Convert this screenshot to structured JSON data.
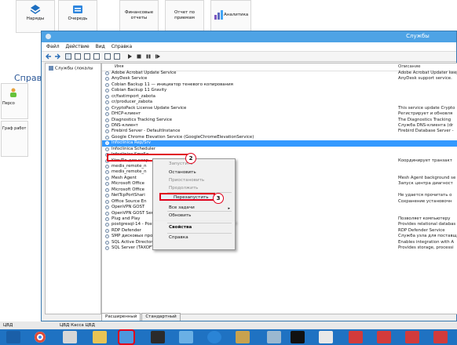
{
  "background_app": {
    "ribbon": [
      "Наряды",
      "Очередь",
      "Финансовые отчеты",
      "Отчет по приемам",
      "Аналитика"
    ],
    "section_title": "Справ",
    "side_tiles": [
      "Персо",
      "Граф работ"
    ]
  },
  "window": {
    "title": "Службы",
    "menu": [
      "Файл",
      "Действие",
      "Вид",
      "Справка"
    ],
    "tree_root": "Службы (локалы",
    "columns": {
      "name": "Имя",
      "description": "Описание"
    },
    "rows": [
      {
        "name": "Adobe Acrobat Update Service",
        "desc": "Adobe Acrobat Updater keeps"
      },
      {
        "name": "AnyDesk Service",
        "desc": "AnyDesk support service."
      },
      {
        "name": "Cobian Backup 11 — инициатор теневого копирования",
        "desc": ""
      },
      {
        "name": "Cobian Backup 11 Gravity",
        "desc": ""
      },
      {
        "name": "cr/fastimport_zabota",
        "desc": ""
      },
      {
        "name": "cr/producer_zabota",
        "desc": ""
      },
      {
        "name": "CryptoPack License Update Service",
        "desc": "This service update Crypto"
      },
      {
        "name": "DHCP-клиент",
        "desc": "Регистрирует и обновля"
      },
      {
        "name": "Diagnostics Tracking Service",
        "desc": "The Diagnostics Tracking"
      },
      {
        "name": "DNS-клиент",
        "desc": "Служба DNS-клиента (dr"
      },
      {
        "name": "Firebird Server - DefaultInstance",
        "desc": "Firebird Database Server -"
      },
      {
        "name": "Google Chrome Elevation Service (GoogleChromeElevationService)",
        "desc": ""
      },
      {
        "name": "Infoclinica Rep/Srv",
        "desc": ""
      },
      {
        "name": "Infoclinica Scheduler",
        "desc": ""
      },
      {
        "name": "Infoclinica SmsSe",
        "desc": ""
      },
      {
        "name": "Ktm/Rn для коор",
        "desc": "Координирует транзакт"
      },
      {
        "name": "medis_remote_n",
        "desc": ""
      },
      {
        "name": "medis_remote_n",
        "desc": ""
      },
      {
        "name": "Mesh Agent",
        "desc": "Mesh Agent background se"
      },
      {
        "name": "Microsoft Office",
        "desc": "Запуск центра диагност"
      },
      {
        "name": "Microsoft Office",
        "desc": ""
      },
      {
        "name": "NetTcpPortShari",
        "desc": "Не удается прочитать о"
      },
      {
        "name": "Office Source En",
        "desc": "Сохранение установочн"
      },
      {
        "name": "OpenVPN GOST",
        "desc": ""
      },
      {
        "name": "OpenVPN GOST Service",
        "desc": ""
      },
      {
        "name": "Plug and Play",
        "desc": "Позволяет компьютеру"
      },
      {
        "name": "postgresql-14 - PostgreSQL Server 14",
        "desc": "Provides relational databas"
      },
      {
        "name": "RDP Defender",
        "desc": "RDP Defender Service"
      },
      {
        "name": "SMP дисковых пространств (Майкрософт)",
        "desc": "Служба узла для поставщ"
      },
      {
        "name": "SQL Active Directory Helper Service",
        "desc": "Enables integration with A"
      },
      {
        "name": "SQL Server (TAXOFTNET)",
        "desc": "Provides storage, processi"
      }
    ],
    "selected_index": 12,
    "tabs": [
      "Расширенный",
      "Стандартный"
    ]
  },
  "context_menu": {
    "items": [
      {
        "label": "Запустить",
        "disabled": true
      },
      {
        "label": "Остановить",
        "disabled": false
      },
      {
        "label": "Приостановить",
        "disabled": true
      },
      {
        "label": "Продолжить",
        "disabled": true
      },
      {
        "label": "Перезапустить",
        "disabled": false
      },
      {
        "label": "Все задачи",
        "disabled": false
      },
      {
        "label": "Обновить",
        "disabled": false
      },
      {
        "label": "Свойства",
        "disabled": false
      },
      {
        "label": "Справка",
        "disabled": false
      }
    ]
  },
  "badges": [
    "1",
    "2",
    "3"
  ],
  "taskbar": {
    "labels": [
      "ЦВД",
      "ЦВД Касса ЦВД"
    ]
  },
  "colors": {
    "accent": "#3399ff",
    "highlight": "#e0001b",
    "taskbar": "#1f72c2"
  }
}
